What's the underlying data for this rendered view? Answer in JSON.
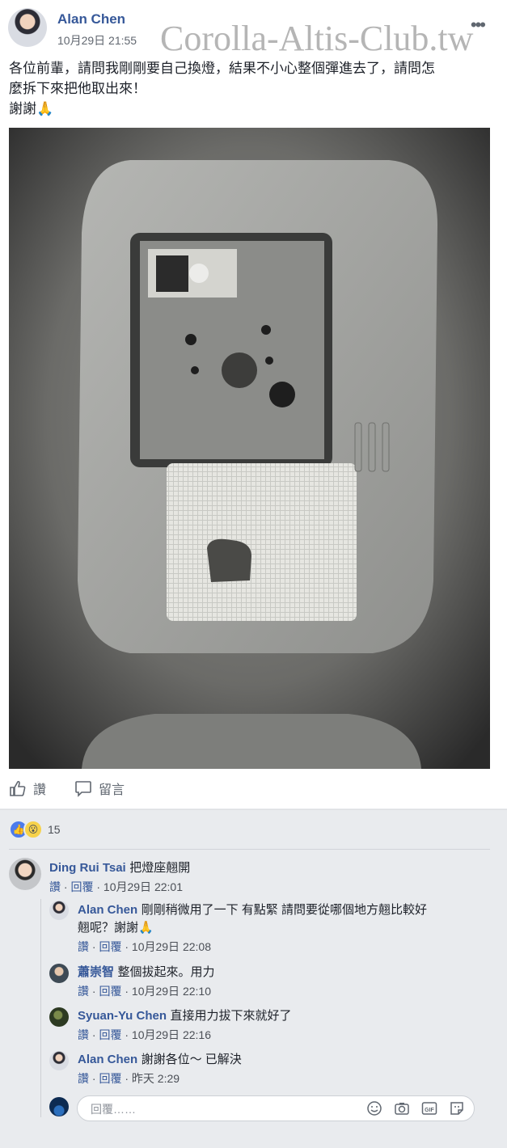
{
  "post": {
    "author": "Alan Chen",
    "timestamp": "10月29日 21:55",
    "watermark": "Corolla-Altis-Club.tw",
    "text_line1": "各位前輩，請問我剛剛要自己換燈，結果不小心整個彈進去了，請問怎",
    "text_line2": "麼拆下來把他取出來！",
    "text_line3": "謝謝🙏",
    "more_glyph": "•••"
  },
  "actions": {
    "like_label": "讚",
    "comment_label": "留言"
  },
  "reactions": {
    "count": "15",
    "like_glyph": "👍",
    "wow_glyph": "😮"
  },
  "comments": [
    {
      "name": "Ding Rui Tsai",
      "text": "把燈座翹開",
      "like": "讚",
      "reply": "回覆",
      "time": "10月29日 22:01"
    },
    {
      "name": "Alan Chen",
      "text_line1": "剛剛稍微用了一下 有點緊 請問要從哪個地方翹比較好",
      "text_line2": "翹呢？謝謝🙏",
      "like": "讚",
      "reply": "回覆",
      "time": "10月29日 22:08"
    },
    {
      "name": "蕭崇智",
      "text": "整個拔起來。用力",
      "like": "讚",
      "reply": "回覆",
      "time": "10月29日 22:10"
    },
    {
      "name": "Syuan-Yu Chen",
      "text": "直接用力拔下來就好了",
      "like": "讚",
      "reply": "回覆",
      "time": "10月29日 22:16"
    },
    {
      "name": "Alan Chen",
      "text": "謝謝各位～ 已解決",
      "like": "讚",
      "reply": "回覆",
      "time": "昨天 2:29"
    }
  ],
  "reply_box": {
    "placeholder": "回覆……"
  },
  "dot_sep": "·",
  "colors": {
    "link": "#365899",
    "like_blue": "#4c7bec",
    "wow_yellow": "#f7d24a",
    "page_bg": "#e9ebee"
  }
}
